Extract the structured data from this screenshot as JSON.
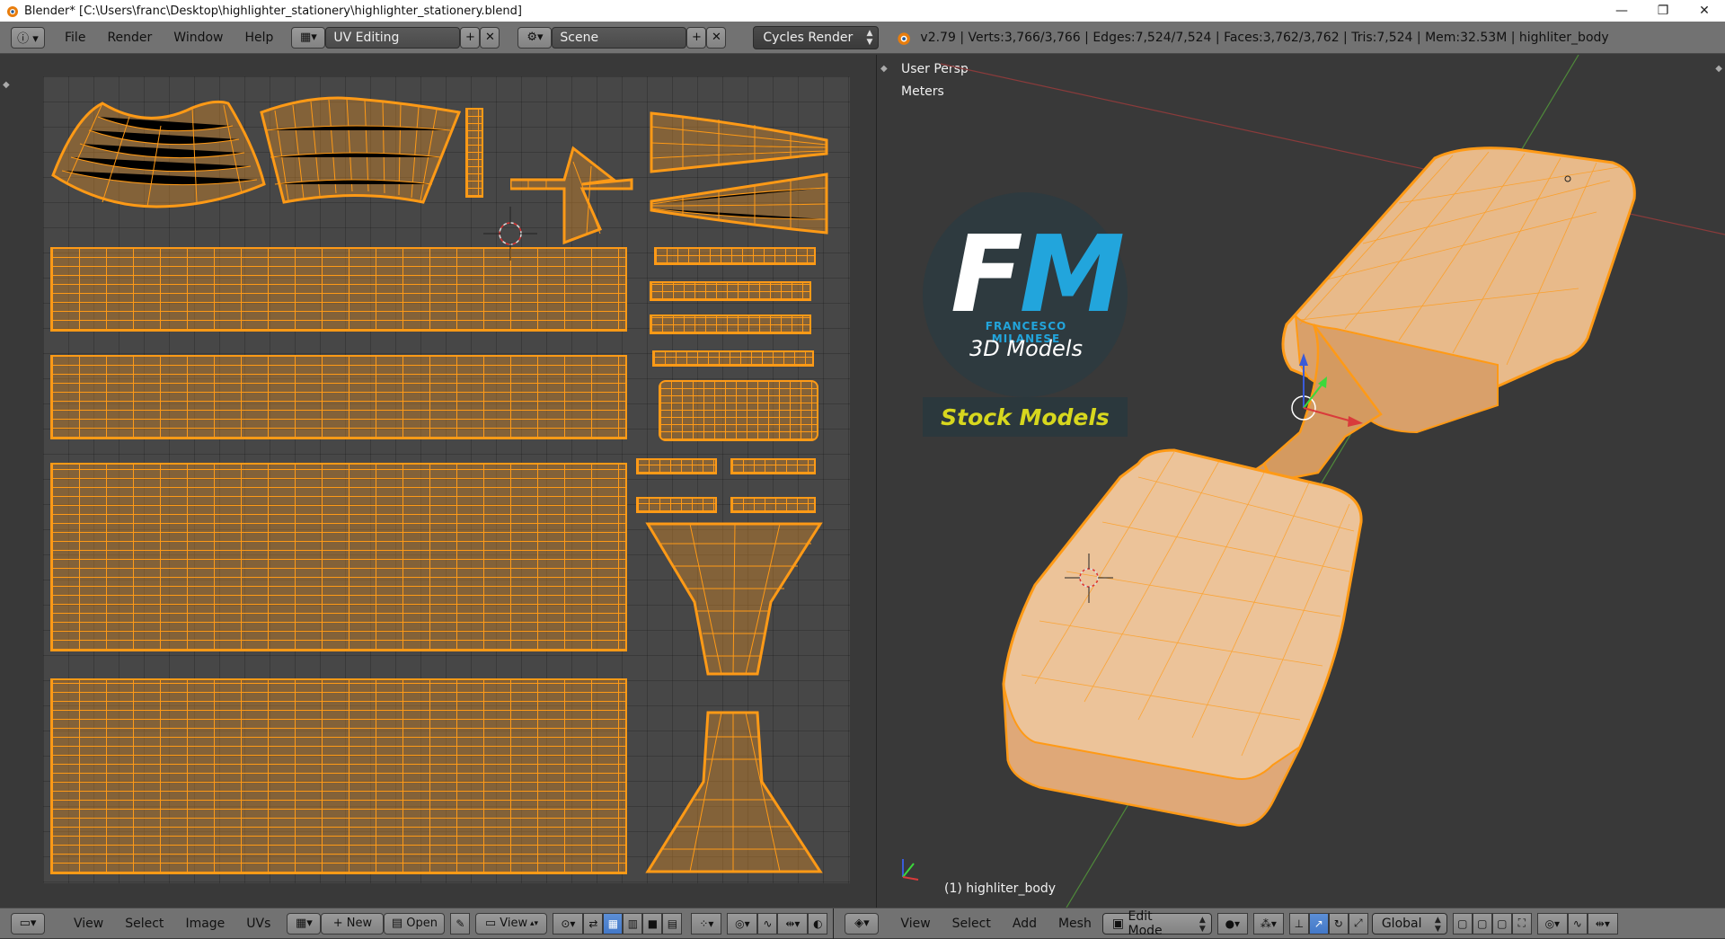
{
  "window": {
    "title": "Blender* [C:\\Users\\franc\\Desktop\\highlighter_stationery\\highlighter_stationery.blend]",
    "minimize": "—",
    "maximize": "❐",
    "close": "✕"
  },
  "topbar": {
    "menus": [
      "File",
      "Render",
      "Window",
      "Help"
    ],
    "layout_value": "UV Editing",
    "scene_value": "Scene",
    "engine_value": "Cycles Render",
    "stats": "v2.79 | Verts:3,766/3,766 | Edges:7,524/7,524 | Faces:3,762/3,762 | Tris:7,524 | Mem:32.53M | highliter_body"
  },
  "viewport": {
    "view_name": "User Persp",
    "units": "Meters",
    "object_label": "(1) highliter_body"
  },
  "logo": {
    "fm_f": "F",
    "fm_m": "M",
    "name": "FRANCESCO MILANESE",
    "subtitle": "3D Models",
    "stock": "Stock Models"
  },
  "uv_footer": {
    "menus": [
      "View",
      "Select",
      "Image",
      "UVs"
    ],
    "new_label": "New",
    "open_label": "Open",
    "view_label": "View"
  },
  "vp_footer": {
    "menus": [
      "View",
      "Select",
      "Add",
      "Mesh"
    ],
    "mode_value": "Edit Mode",
    "orientation_value": "Global"
  },
  "colors": {
    "wire": "#ff9a16",
    "background": "#393939",
    "header": "#727272"
  }
}
